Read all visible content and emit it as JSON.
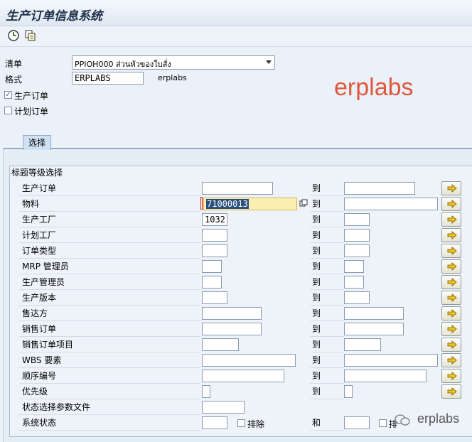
{
  "window": {
    "title": "生产订单信息系统"
  },
  "toolbar": {
    "icons": [
      "execute-icon",
      "variant-icon"
    ]
  },
  "header": {
    "list_label": "清单",
    "list_value": "PPIOH000 ส่วนหัวของใบสั่ง",
    "format_label": "格式",
    "format_value": "ERPLABS",
    "format_desc": "erplabs",
    "prod_order_label": "生产订单",
    "prod_order_checked": true,
    "plan_order_label": "计划订单",
    "plan_order_checked": false
  },
  "watermark": "erplabs",
  "footer_watermark": "erplabs",
  "tab": {
    "label": "选择"
  },
  "group": {
    "title": "标题等级选择"
  },
  "to_label": "到",
  "and_label": "和",
  "exclude_label": "排除",
  "exclude_label_short": "排",
  "rows": [
    {
      "label": "生产订单",
      "from": "",
      "to": ""
    },
    {
      "label": "物料",
      "from": "71000013",
      "to": ""
    },
    {
      "label": "生产工厂",
      "from": "1032",
      "to": ""
    },
    {
      "label": "计划工厂",
      "from": "",
      "to": ""
    },
    {
      "label": "订单类型",
      "from": "",
      "to": ""
    },
    {
      "label": "MRP 管理员",
      "from": "",
      "to": ""
    },
    {
      "label": "生产管理员",
      "from": "",
      "to": ""
    },
    {
      "label": "生产版本",
      "from": "",
      "to": ""
    },
    {
      "label": "售达方",
      "from": "",
      "to": ""
    },
    {
      "label": "销售订单",
      "from": "",
      "to": ""
    },
    {
      "label": "销售订单项目",
      "from": "",
      "to": ""
    },
    {
      "label": "WBS 要素",
      "from": "",
      "to": ""
    },
    {
      "label": "顺序编号",
      "from": "",
      "to": ""
    },
    {
      "label": "优先级",
      "from": "",
      "to": ""
    },
    {
      "label": "状态选择参数文件",
      "from": ""
    },
    {
      "label": "系统状态",
      "from": "",
      "to": ""
    }
  ]
}
